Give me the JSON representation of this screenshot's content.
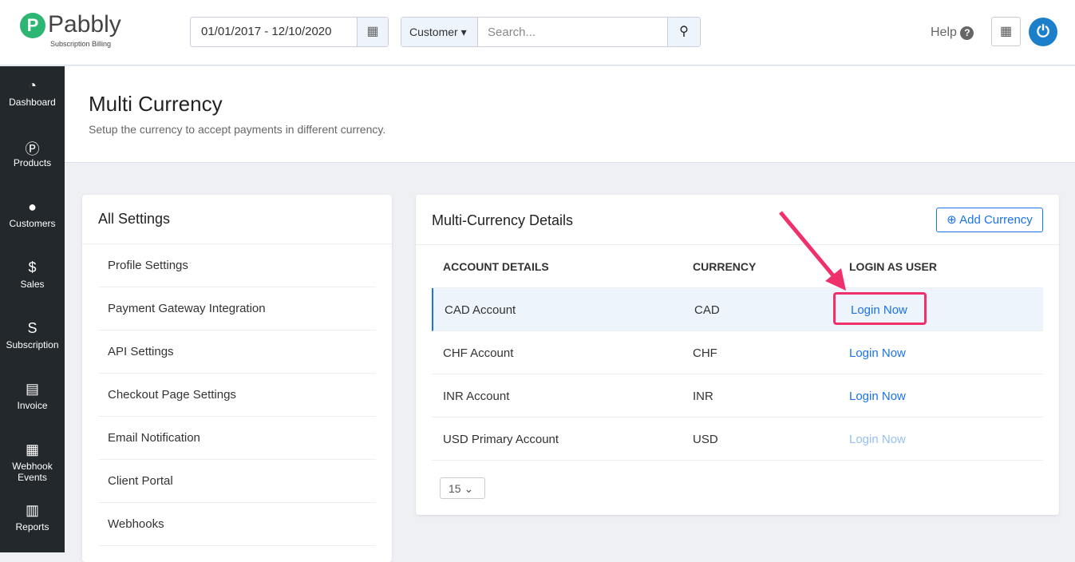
{
  "header": {
    "logo": "Pabbly",
    "logo_sub": "Subscription Billing",
    "date_range": "01/01/2017 - 12/10/2020",
    "search_type": "Customer",
    "search_placeholder": "Search...",
    "help": "Help"
  },
  "sidebar": [
    {
      "icon": "◔",
      "label": "Dashboard"
    },
    {
      "icon": "Ⓟ",
      "label": "Products"
    },
    {
      "icon": "●",
      "label": "Customers"
    },
    {
      "icon": "$",
      "label": "Sales"
    },
    {
      "icon": "S",
      "label": "Subscription"
    },
    {
      "icon": "▤",
      "label": "Invoice"
    },
    {
      "icon": "▦",
      "label": "Webhook Events"
    },
    {
      "icon": "▥",
      "label": "Reports"
    }
  ],
  "page": {
    "title": "Multi Currency",
    "subtitle": "Setup the currency to accept payments in different currency."
  },
  "settings": {
    "title": "All Settings",
    "items": [
      "Profile Settings",
      "Payment Gateway Integration",
      "API Settings",
      "Checkout Page Settings",
      "Email Notification",
      "Client Portal",
      "Webhooks"
    ]
  },
  "details": {
    "title": "Multi-Currency Details",
    "add": "Add Currency",
    "columns": [
      "ACCOUNT DETAILS",
      "CURRENCY",
      "LOGIN AS USER"
    ],
    "rows": [
      {
        "account": "CAD Account",
        "currency": "CAD",
        "login": "Login Now"
      },
      {
        "account": "CHF Account",
        "currency": "CHF",
        "login": "Login Now"
      },
      {
        "account": "INR Account",
        "currency": "INR",
        "login": "Login Now"
      },
      {
        "account": "USD Primary Account",
        "currency": "USD",
        "login": "Login Now"
      }
    ],
    "page_size": "15"
  }
}
